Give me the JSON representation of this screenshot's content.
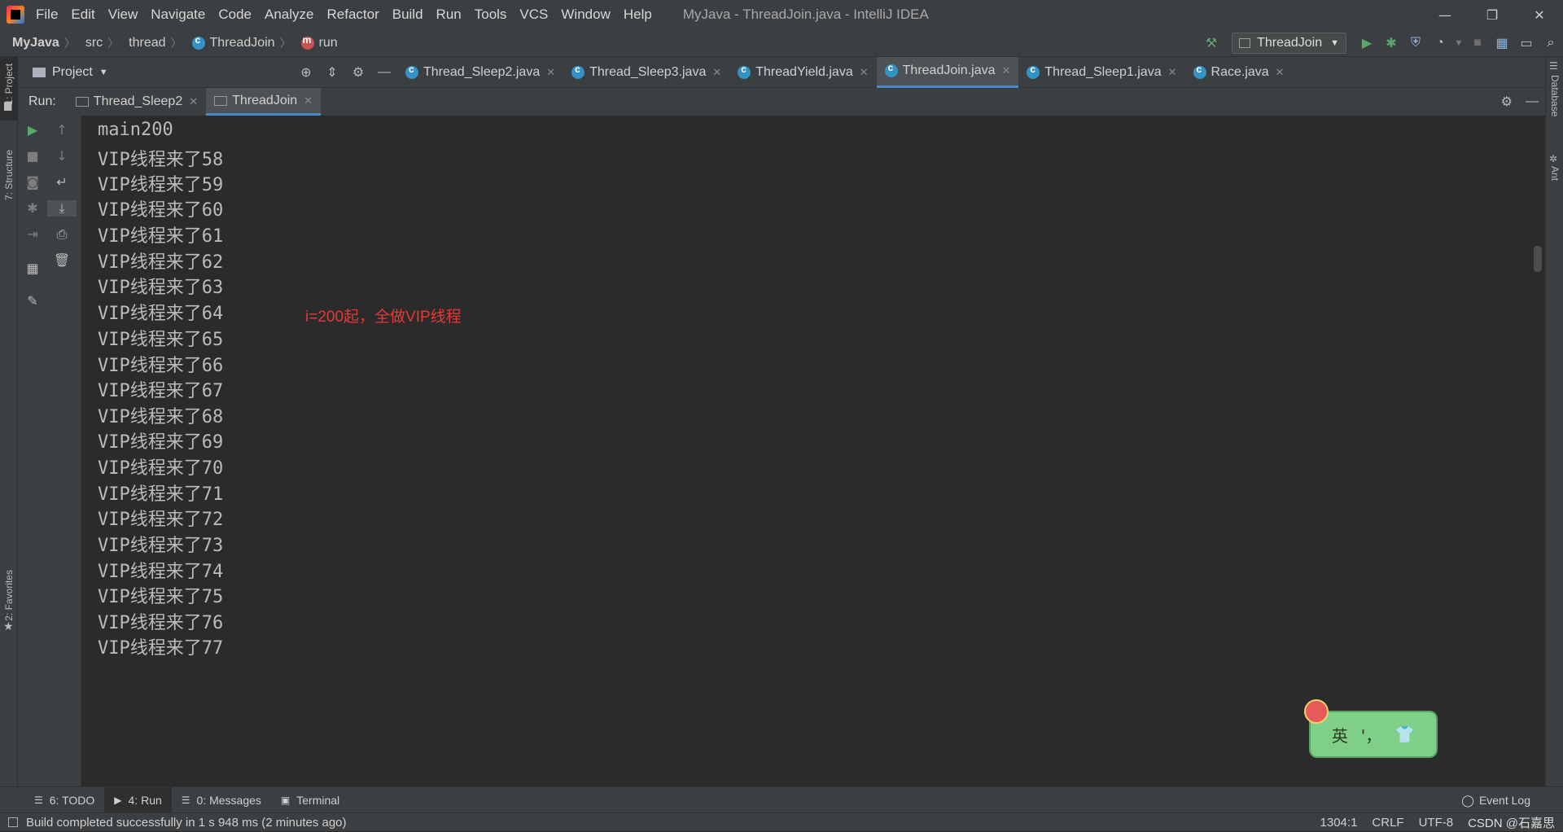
{
  "titlebar": {
    "menu": [
      "File",
      "Edit",
      "View",
      "Navigate",
      "Code",
      "Analyze",
      "Refactor",
      "Build",
      "Run",
      "Tools",
      "VCS",
      "Window",
      "Help"
    ],
    "window_title": "MyJava - ThreadJoin.java - IntelliJ IDEA"
  },
  "breadcrumb": {
    "project": "MyJava",
    "src": "src",
    "package": "thread",
    "class": "ThreadJoin",
    "method": "run"
  },
  "run_config": {
    "label": "ThreadJoin"
  },
  "project_panel": {
    "label": "Project"
  },
  "editor_tabs": [
    {
      "label": "Thread_Sleep2.java",
      "active": false
    },
    {
      "label": "Thread_Sleep3.java",
      "active": false
    },
    {
      "label": "ThreadYield.java",
      "active": false
    },
    {
      "label": "ThreadJoin.java",
      "active": true
    },
    {
      "label": "Thread_Sleep1.java",
      "active": false
    },
    {
      "label": "Race.java",
      "active": false
    }
  ],
  "run_panel": {
    "label": "Run:",
    "tabs": [
      {
        "label": "Thread_Sleep2",
        "active": false
      },
      {
        "label": "ThreadJoin",
        "active": true
      }
    ]
  },
  "console": {
    "lines": [
      "main200",
      "VIP线程来了58",
      "VIP线程来了59",
      "VIP线程来了60",
      "VIP线程来了61",
      "VIP线程来了62",
      "VIP线程来了63",
      "VIP线程来了64",
      "VIP线程来了65",
      "VIP线程来了66",
      "VIP线程来了67",
      "VIP线程来了68",
      "VIP线程来了69",
      "VIP线程来了70",
      "VIP线程来了71",
      "VIP线程来了72",
      "VIP线程来了73",
      "VIP线程来了74",
      "VIP线程来了75",
      "VIP线程来了76",
      "VIP线程来了77"
    ],
    "annotation": "i=200起，全做VIP线程"
  },
  "side_strips": {
    "left_top": [
      "1: Project",
      "7: Structure"
    ],
    "left_bottom": "2: Favorites",
    "right": [
      "Database",
      "Ant"
    ]
  },
  "ime": {
    "lang": "英",
    "punct": "'，",
    "shirt": "👕"
  },
  "bottom_tabs": [
    {
      "label": "6: TODO"
    },
    {
      "label": "4: Run",
      "active": true
    },
    {
      "label": "0: Messages"
    },
    {
      "label": "Terminal"
    }
  ],
  "event_log": "Event Log",
  "status": {
    "message": "Build completed successfully in 1 s 948 ms (2 minutes ago)",
    "position": "1304:1",
    "line_sep": "CRLF",
    "encoding": "UTF-8",
    "watermark": "CSDN @石嘉思"
  },
  "colors": {
    "accent": "#4a88c7",
    "run_green": "#59a869",
    "annotation_red": "#e53935"
  }
}
